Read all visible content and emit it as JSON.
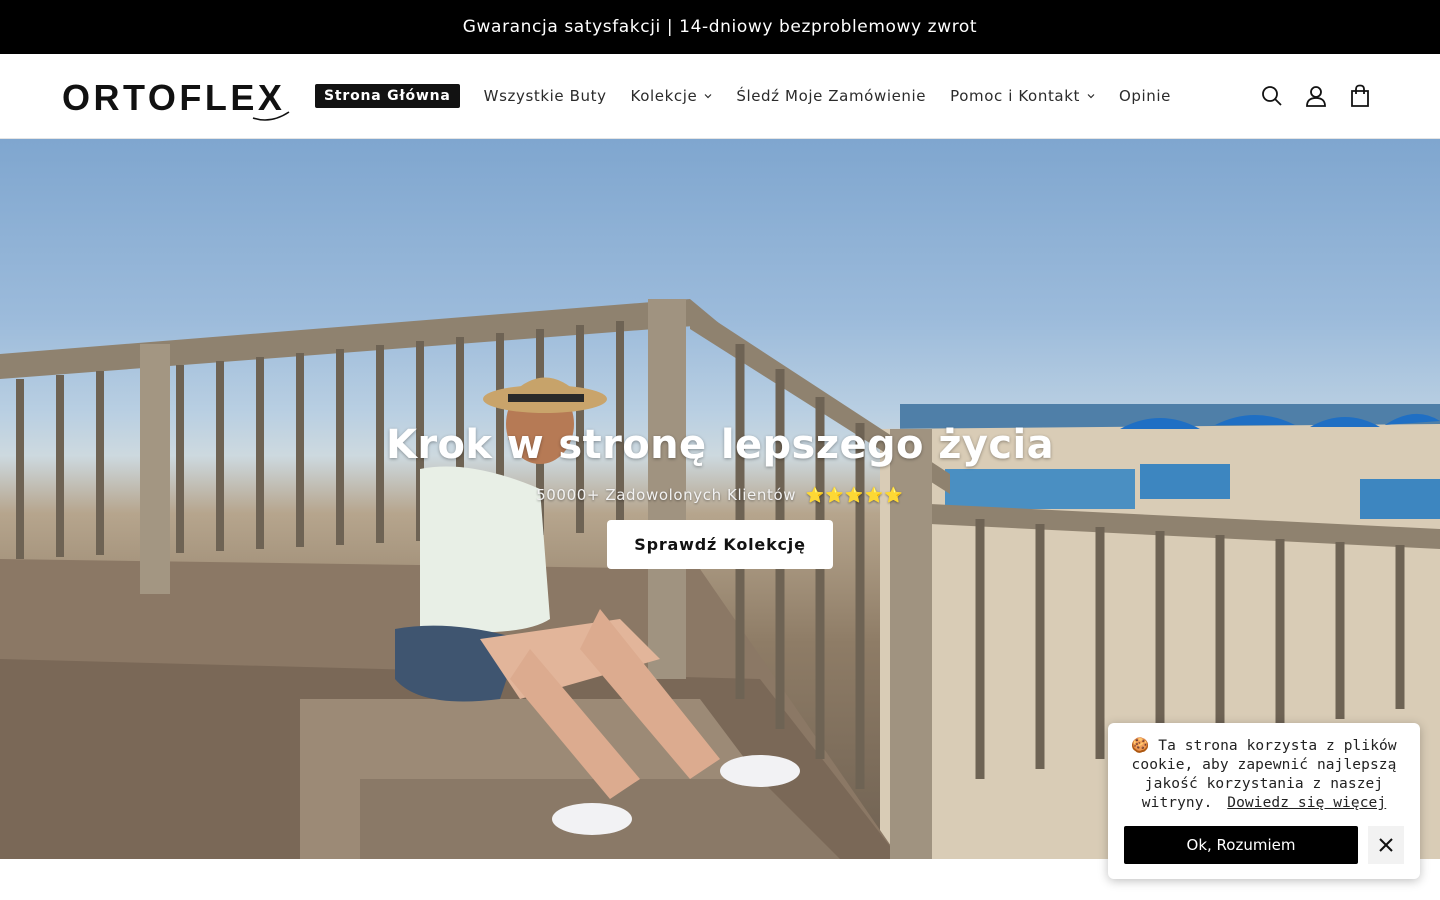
{
  "announcement": {
    "text": "Gwarancja satysfakcji | 14-dniowy bezproblemowy zwrot"
  },
  "header": {
    "logo_text": "ORTOFLEX",
    "nav": [
      {
        "label": "Strona Główna",
        "active": true,
        "dropdown": false
      },
      {
        "label": "Wszystkie Buty",
        "active": false,
        "dropdown": false
      },
      {
        "label": "Kolekcje",
        "active": false,
        "dropdown": true
      },
      {
        "label": "Śledź Moje Zamówienie",
        "active": false,
        "dropdown": false
      },
      {
        "label": "Pomoc i Kontakt",
        "active": false,
        "dropdown": true
      },
      {
        "label": "Opinie",
        "active": false,
        "dropdown": false
      }
    ],
    "icons": [
      "search-icon",
      "account-icon",
      "cart-icon"
    ]
  },
  "hero": {
    "title": "Krok w stronę lepszego życia",
    "subtitle": "50000+ Zadowolonych Klientów",
    "stars": "⭐⭐⭐⭐⭐",
    "button_label": "Sprawdź Kolekcję"
  },
  "cookie": {
    "emoji": "🍪",
    "text": "Ta strona korzysta z plików cookie, aby zapewnić najlepszą jakość korzystania z naszej witryny.",
    "link": "Dowiedz się więcej",
    "accept_label": "Ok, Rozumiem",
    "close_icon": "close-icon"
  },
  "colors": {
    "announcement_bg": "#000000",
    "active_nav_bg": "#121212",
    "button_bg": "#ffffff",
    "cookie_accept_bg": "#000000",
    "stars": "#f5c518"
  }
}
